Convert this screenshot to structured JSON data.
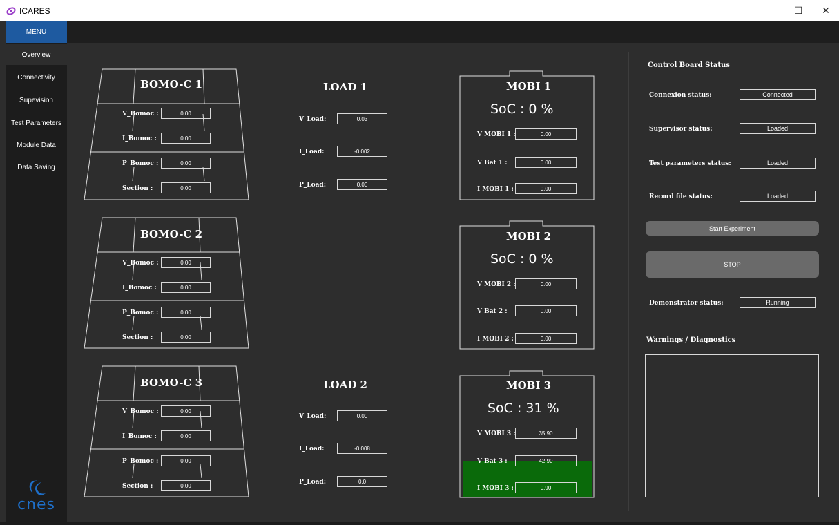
{
  "window": {
    "title": "ICARES",
    "minimize": "–",
    "maximize": "☐",
    "close": "✕"
  },
  "menu": {
    "label": "MENU"
  },
  "sidebar": {
    "items": [
      {
        "label": "Overview"
      },
      {
        "label": "Connectivity"
      },
      {
        "label": "Supevision"
      },
      {
        "label": "Test Parameters"
      },
      {
        "label": "Module Data"
      },
      {
        "label": "Data Saving"
      }
    ],
    "logo_text": "cnes"
  },
  "bomo": [
    {
      "title": "BOMO-C 1",
      "v_label": "V_Bomoc :",
      "v": "0.00",
      "i_label": "I_Bomoc :",
      "i": "0.00",
      "p_label": "P_Bomoc :",
      "p": "0.00",
      "s_label": "Section :",
      "s": "0.00"
    },
    {
      "title": "BOMO-C 2",
      "v_label": "V_Bomoc :",
      "v": "0.00",
      "i_label": "I_Bomoc :",
      "i": "0.00",
      "p_label": "P_Bomoc :",
      "p": "0.00",
      "s_label": "Section :",
      "s": "0.00"
    },
    {
      "title": "BOMO-C 3",
      "v_label": "V_Bomoc :",
      "v": "0.00",
      "i_label": "I_Bomoc :",
      "i": "0.00",
      "p_label": "P_Bomoc :",
      "p": "0.00",
      "s_label": "Section :",
      "s": "0.00"
    }
  ],
  "loads": [
    {
      "title": "LOAD 1",
      "v_label": "V_Load:",
      "v": "0.03",
      "i_label": "I_Load:",
      "i": "-0.002",
      "p_label": "P_Load:",
      "p": "0.00"
    },
    {
      "title": "LOAD 2",
      "v_label": "V_Load:",
      "v": "0.00",
      "i_label": "I_Load:",
      "i": "-0.008",
      "p_label": "P_Load:",
      "p": "0.0"
    }
  ],
  "mobi": [
    {
      "title": "MOBI 1",
      "soc": "SoC :  0 %",
      "vm_label": "V MOBI 1 :",
      "vm": "0.00",
      "vb_label": "V Bat 1 :",
      "vb": "0.00",
      "im_label": "I MOBI 1 :",
      "im": "0.00"
    },
    {
      "title": "MOBI 2",
      "soc": "SoC :  0 %",
      "vm_label": "V MOBI 2 :",
      "vm": "0.00",
      "vb_label": "V Bat 2 :",
      "vb": "0.00",
      "im_label": "I MOBI 2 :",
      "im": "0.00"
    },
    {
      "title": "MOBI 3",
      "soc": "SoC : 31 %",
      "vm_label": "V MOBI 3 :",
      "vm": "35.90",
      "vb_label": "V Bat 3 :",
      "vb": "42.90",
      "im_label": "I MOBI 3 :",
      "im": "0.90",
      "highlight_color": "#0a6a0a"
    }
  ],
  "control": {
    "heading": "Control Board Status",
    "connexion_label": "Connexion status:",
    "connexion": "Connected",
    "supervisor_label": "Supervisor status:",
    "supervisor": "Loaded",
    "test_label": "Test parameters status:",
    "test": "Loaded",
    "record_label": "Record file status:",
    "record": "Loaded",
    "start_button": "Start Experiment",
    "stop_button": "STOP",
    "demo_label": "Demonstrator status:",
    "demo": "Running",
    "warnings_heading": "Warnings / Diagnostics"
  },
  "colors": {
    "accent": "#1e5aa0",
    "background": "#2d2d2d",
    "sidebar": "#1c1c1c"
  }
}
